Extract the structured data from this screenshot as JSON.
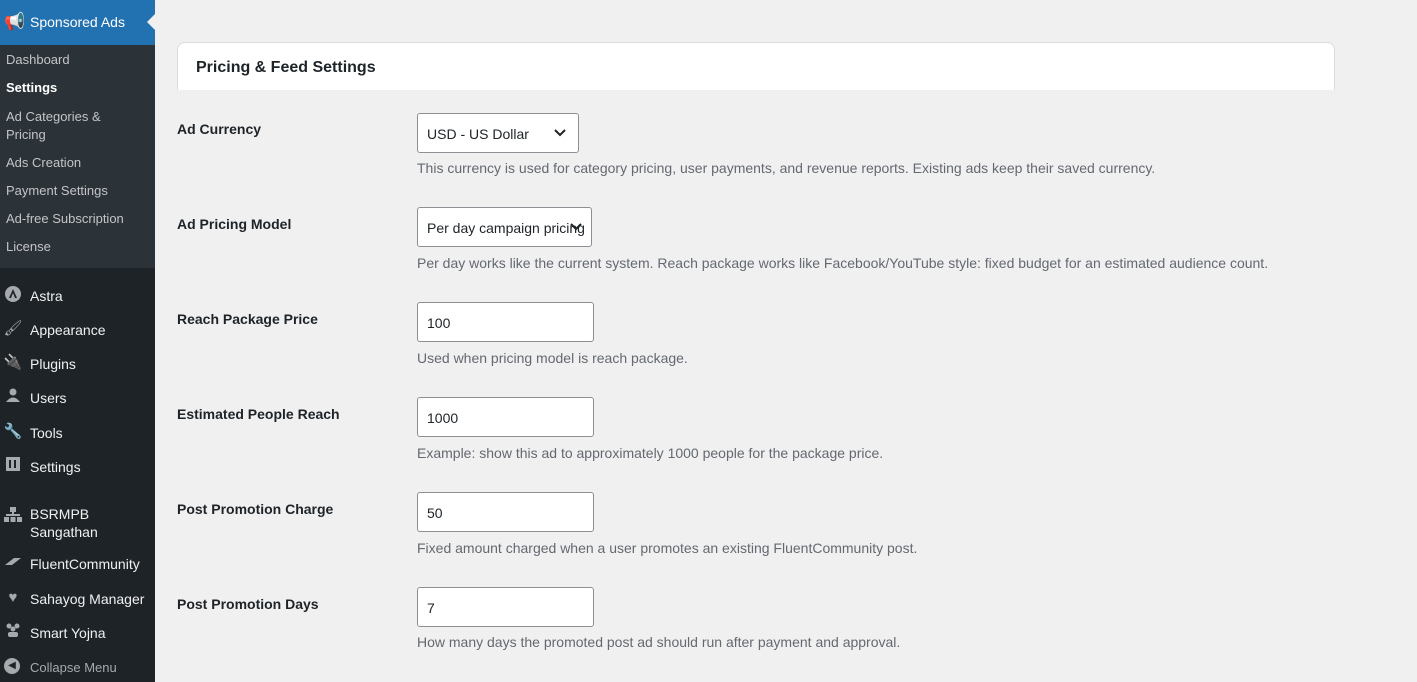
{
  "sidebar": {
    "plugin_title": "Sponsored Ads",
    "submenu": [
      {
        "label": "Dashboard",
        "current": false
      },
      {
        "label": "Settings",
        "current": true
      },
      {
        "label": "Ad Categories & Pricing",
        "current": false
      },
      {
        "label": "Ads Creation",
        "current": false
      },
      {
        "label": "Payment Settings",
        "current": false
      },
      {
        "label": "Ad-free Subscription",
        "current": false
      },
      {
        "label": "License",
        "current": false
      }
    ],
    "menu": [
      {
        "label": "Astra",
        "icon": "astra-icon"
      },
      {
        "label": "Appearance",
        "icon": "paintbrush-icon"
      },
      {
        "label": "Plugins",
        "icon": "plugin-icon"
      },
      {
        "label": "Users",
        "icon": "users-icon"
      },
      {
        "label": "Tools",
        "icon": "wrench-icon"
      },
      {
        "label": "Settings",
        "icon": "settings-icon"
      },
      {
        "label": "BSRMPB Sangathan",
        "icon": "network-icon"
      },
      {
        "label": "FluentCommunity",
        "icon": "fluent-icon"
      },
      {
        "label": "Sahayog Manager",
        "icon": "heart-icon"
      },
      {
        "label": "Smart Yojna",
        "icon": "group-icon"
      }
    ],
    "collapse_label": "Collapse Menu"
  },
  "card": {
    "title": "Pricing & Feed Settings"
  },
  "settings": [
    {
      "label": "Ad Currency",
      "value": "USD - US Dollar",
      "type": "select",
      "description": "This currency is used for category pricing, user payments, and revenue reports. Existing ads keep their saved currency."
    },
    {
      "label": "Ad Pricing Model",
      "value": "Per day campaign pricing",
      "type": "select",
      "description": "Per day works like the current system. Reach package works like Facebook/YouTube style: fixed budget for an estimated audience count."
    },
    {
      "label": "Reach Package Price",
      "value": "100",
      "type": "number",
      "description": "Used when pricing model is reach package."
    },
    {
      "label": "Estimated People Reach",
      "value": "1000",
      "type": "number",
      "description": "Example: show this ad to approximately 1000 people for the package price."
    },
    {
      "label": "Post Promotion Charge",
      "value": "50",
      "type": "number",
      "description": "Fixed amount charged when a user promotes an existing FluentCommunity post."
    },
    {
      "label": "Post Promotion Days",
      "value": "7",
      "type": "number",
      "description": "How many days the promoted post ad should run after payment and approval."
    }
  ],
  "colors": {
    "sidebar_bg": "#1d2327",
    "submenu_bg": "#2c3338",
    "accent": "#2271b1",
    "page_bg": "#f0f0f1"
  }
}
